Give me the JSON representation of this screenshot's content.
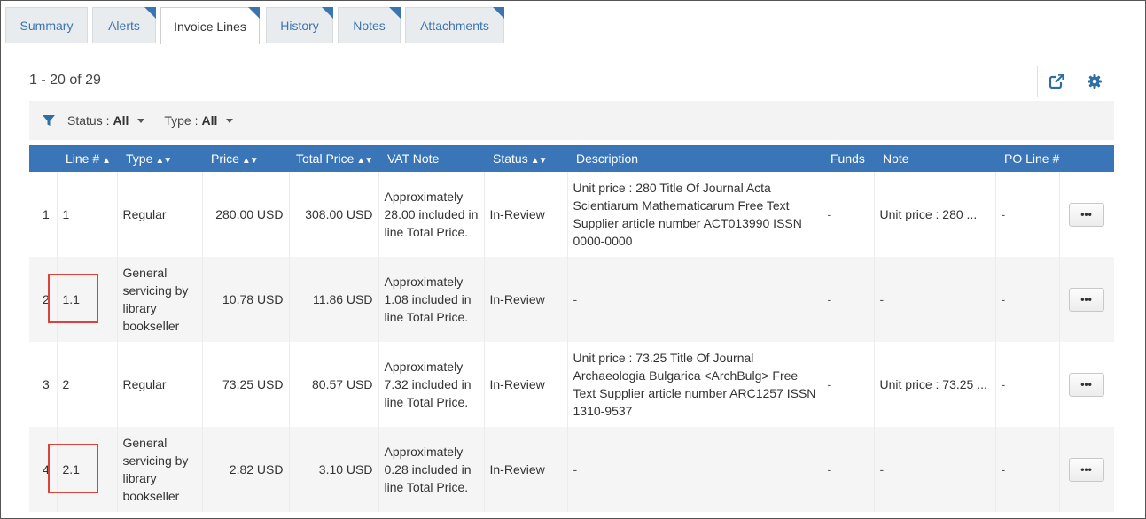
{
  "tabs": [
    {
      "label": "Summary",
      "active": false,
      "corner": false
    },
    {
      "label": "Alerts",
      "active": false,
      "corner": true
    },
    {
      "label": "Invoice Lines",
      "active": true,
      "corner": true
    },
    {
      "label": "History",
      "active": false,
      "corner": true
    },
    {
      "label": "Notes",
      "active": false,
      "corner": true
    },
    {
      "label": "Attachments",
      "active": false,
      "corner": true
    }
  ],
  "results_count": "1 - 20 of 29",
  "icons": {
    "export": "export-icon",
    "settings": "gear-icon",
    "filter": "filter-icon",
    "more": "ellipsis-icon"
  },
  "filters": [
    {
      "label": "Status :",
      "value": "All"
    },
    {
      "label": "Type :",
      "value": "All"
    }
  ],
  "columns": [
    {
      "label": "",
      "sort": ""
    },
    {
      "label": "Line #",
      "sort": "▲"
    },
    {
      "label": "Type",
      "sort": "▲▼"
    },
    {
      "label": "Price",
      "sort": "▲▼"
    },
    {
      "label": "Total Price",
      "sort": "▲▼"
    },
    {
      "label": "VAT Note",
      "sort": ""
    },
    {
      "label": "Status",
      "sort": "▲▼"
    },
    {
      "label": "Description",
      "sort": ""
    },
    {
      "label": "Funds",
      "sort": ""
    },
    {
      "label": "Note",
      "sort": ""
    },
    {
      "label": "PO Line #",
      "sort": ""
    },
    {
      "label": "",
      "sort": ""
    }
  ],
  "rows": [
    {
      "index": "1",
      "line": "1",
      "type": "Regular",
      "price": "280.00 USD",
      "total": "308.00 USD",
      "vat": "Approximately 28.00 included in line Total Price.",
      "status": "In-Review",
      "description": "Unit price : 280 Title Of Journal Acta Scientiarum Mathematicarum Free Text Supplier article number ACT013990 ISSN 0000-0000",
      "funds": "-",
      "note": "Unit price : 280 ...",
      "po_line": "-"
    },
    {
      "index": "2",
      "line": "1.1",
      "type": "General servicing by library bookseller",
      "price": "10.78 USD",
      "total": "11.86 USD",
      "vat": "Approximately 1.08 included in line Total Price.",
      "status": "In-Review",
      "description": "-",
      "funds": "-",
      "note": "-",
      "po_line": "-"
    },
    {
      "index": "3",
      "line": "2",
      "type": "Regular",
      "price": "73.25 USD",
      "total": "80.57 USD",
      "vat": "Approximately 7.32 included in line Total Price.",
      "status": "In-Review",
      "description": "Unit price : 73.25 Title Of Journal Archaeologia Bulgarica <ArchBulg> Free Text Supplier article number ARC1257 ISSN 1310-9537",
      "funds": "-",
      "note": "Unit price : 73.25 ...",
      "po_line": "-"
    },
    {
      "index": "4",
      "line": "2.1",
      "type": "General servicing by library bookseller",
      "price": "2.82 USD",
      "total": "3.10 USD",
      "vat": "Approximately 0.28 included in line Total Price.",
      "status": "In-Review",
      "description": "-",
      "funds": "-",
      "note": "-",
      "po_line": "-"
    }
  ],
  "more_button_label": "•••"
}
